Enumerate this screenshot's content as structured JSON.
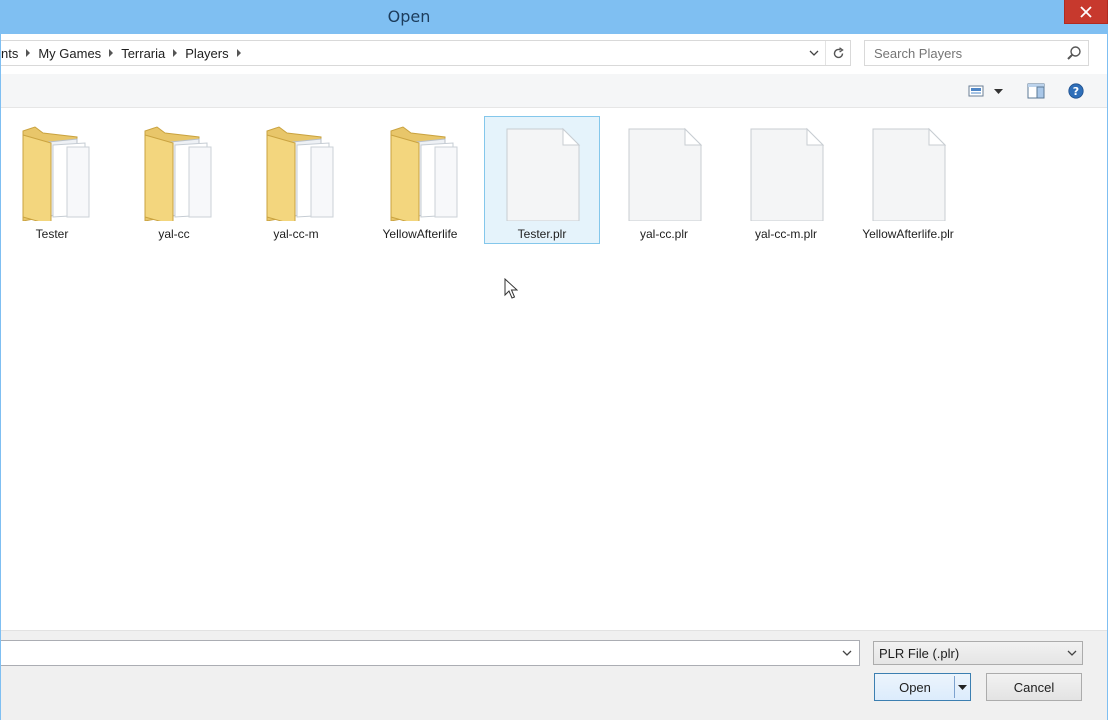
{
  "window": {
    "title": "Open",
    "accent_color": "#7fbff2",
    "close_color": "#c7392d",
    "close_icon": "close-icon"
  },
  "address": {
    "crumbs": [
      "nts",
      "My Games",
      "Terraria",
      "Players"
    ],
    "dropdown_icon": "chevron-down-icon",
    "refresh_icon": "refresh-icon"
  },
  "search": {
    "placeholder": "Search Players",
    "icon": "search-icon"
  },
  "toolbar": {
    "view_icon": "change-view-icon",
    "view_dropdown_icon": "triangle-down-icon",
    "preview_pane_icon": "preview-pane-icon",
    "help_icon": "help-icon",
    "help_glyph": "?"
  },
  "files": [
    {
      "name": "Tester",
      "kind": "folder",
      "selected": false
    },
    {
      "name": "yal-cc",
      "kind": "folder",
      "selected": false
    },
    {
      "name": "yal-cc-m",
      "kind": "folder",
      "selected": false
    },
    {
      "name": "YellowAfterlife",
      "kind": "folder",
      "selected": false
    },
    {
      "name": "Tester.plr",
      "kind": "file",
      "selected": true
    },
    {
      "name": "yal-cc.plr",
      "kind": "file",
      "selected": false
    },
    {
      "name": "yal-cc-m.plr",
      "kind": "file",
      "selected": false
    },
    {
      "name": "YellowAfterlife.plr",
      "kind": "file",
      "selected": false
    }
  ],
  "bottom": {
    "filename_value": "",
    "filetype_selected": "PLR File (.plr)",
    "open_label": "Open",
    "cancel_label": "Cancel"
  }
}
